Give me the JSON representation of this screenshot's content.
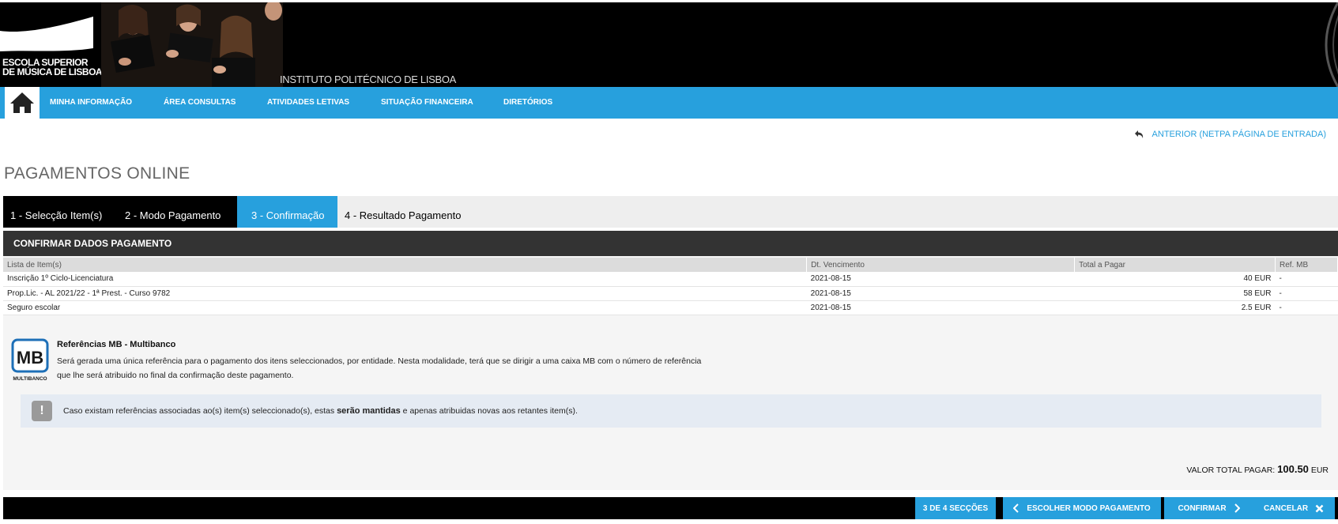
{
  "header": {
    "logo_line1": "ESCOLA SUPERIOR",
    "logo_line2": "DE MÚSICA DE LISBOA",
    "institute": "INSTITUTO POLITÉCNICO DE LISBOA"
  },
  "nav": {
    "home_icon": "home-icon",
    "items": [
      {
        "label": "MINHA INFORMAÇÃO"
      },
      {
        "label": "ÁREA CONSULTAS"
      },
      {
        "label": "ATIVIDADES LETIVAS"
      },
      {
        "label": "SITUAÇÃO FINANCEIRA"
      },
      {
        "label": "DIRETÓRIOS"
      }
    ]
  },
  "back_link": {
    "label": "ANTERIOR (NETPA PÁGINA DE ENTRADA)",
    "icon": "undo-arrow-icon"
  },
  "page_title": "PAGAMENTOS ONLINE",
  "steps": [
    {
      "label": "1 - Selecção Item(s)"
    },
    {
      "label": "2 - Modo Pagamento"
    },
    {
      "label": "3 - Confirmação"
    },
    {
      "label": "4 - Resultado Pagamento"
    }
  ],
  "panel": {
    "title": "CONFIRMAR DADOS PAGAMENTO",
    "columns": [
      "Lista de Item(s)",
      "Dt. Vencimento",
      "Total a Pagar",
      "Ref. MB"
    ],
    "rows": [
      {
        "item": "Inscrição 1º Ciclo-Licenciatura",
        "due": "2021-08-15",
        "total": "40 EUR",
        "ref": "-"
      },
      {
        "item": "Prop.Lic. - AL 2021/22 - 1ª Prest. - Curso 9782",
        "due": "2021-08-15",
        "total": "58 EUR",
        "ref": "-"
      },
      {
        "item": "Seguro escolar",
        "due": "2021-08-15",
        "total": "2.5 EUR",
        "ref": "-"
      }
    ]
  },
  "multibanco": {
    "logo_text": "MB",
    "logo_caption": "MULTIBANCO",
    "title": "Referências MB - Multibanco",
    "desc1": "Será gerada uma única referência para o pagamento dos itens seleccionados, por entidade. Nesta modalidade, terá que se dirigir a uma caixa MB com o número de referência",
    "desc2": "que lhe será atribuido no final da confirmação deste pagamento."
  },
  "note": {
    "icon": "exclamation-icon",
    "pre": "Caso existam referências associadas ao(s) item(s) seleccionado(s), estas ",
    "bold": "serão mantidas",
    "post": " e apenas atribuidas novas aos retantes item(s)."
  },
  "total": {
    "label": "VALOR TOTAL PAGAR:",
    "value": "100.50",
    "currency": "EUR"
  },
  "footer": {
    "sections": "3 DE 4 SECÇÕES",
    "back": "ESCOLHER MODO PAGAMENTO",
    "confirm": "CONFIRMAR",
    "cancel": "CANCELAR"
  },
  "colors": {
    "accent": "#27a0dd",
    "dark": "#000000",
    "panel_head": "#333333"
  }
}
